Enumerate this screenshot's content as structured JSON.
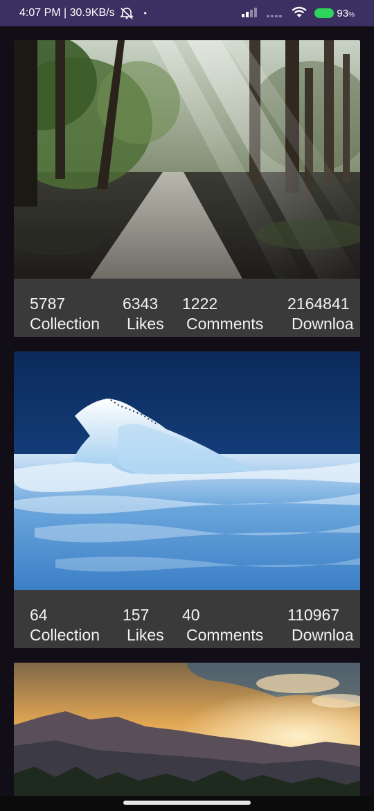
{
  "status_bar": {
    "time": "4:07 PM | 30.9KB/s",
    "dot": "•",
    "battery_percent": "93",
    "battery_unit": "%",
    "battery_color": "#2dd35a",
    "bar_color": "#3c2f62"
  },
  "cards": [
    {
      "image": "forest-path-sunbeams",
      "collection_value": "5787",
      "collection_label": "Collection",
      "likes_value": "6343",
      "likes_label": "Likes",
      "comments_value": "1222",
      "comments_label": "Comments",
      "downloads_value": "2164841",
      "downloads_label": "Downloa"
    },
    {
      "image": "iceberg-in-blue-water",
      "collection_value": "64",
      "collection_label": "Collection",
      "likes_value": "157",
      "likes_label": "Likes",
      "comments_value": "40",
      "comments_label": "Comments",
      "downloads_value": "110967",
      "downloads_label": "Downloa"
    },
    {
      "image": "mountain-sunset"
    }
  ],
  "colors": {
    "background": "#120e17",
    "card_stats_background": "#3a3a3a",
    "stats_text": "#f2f2f2"
  }
}
